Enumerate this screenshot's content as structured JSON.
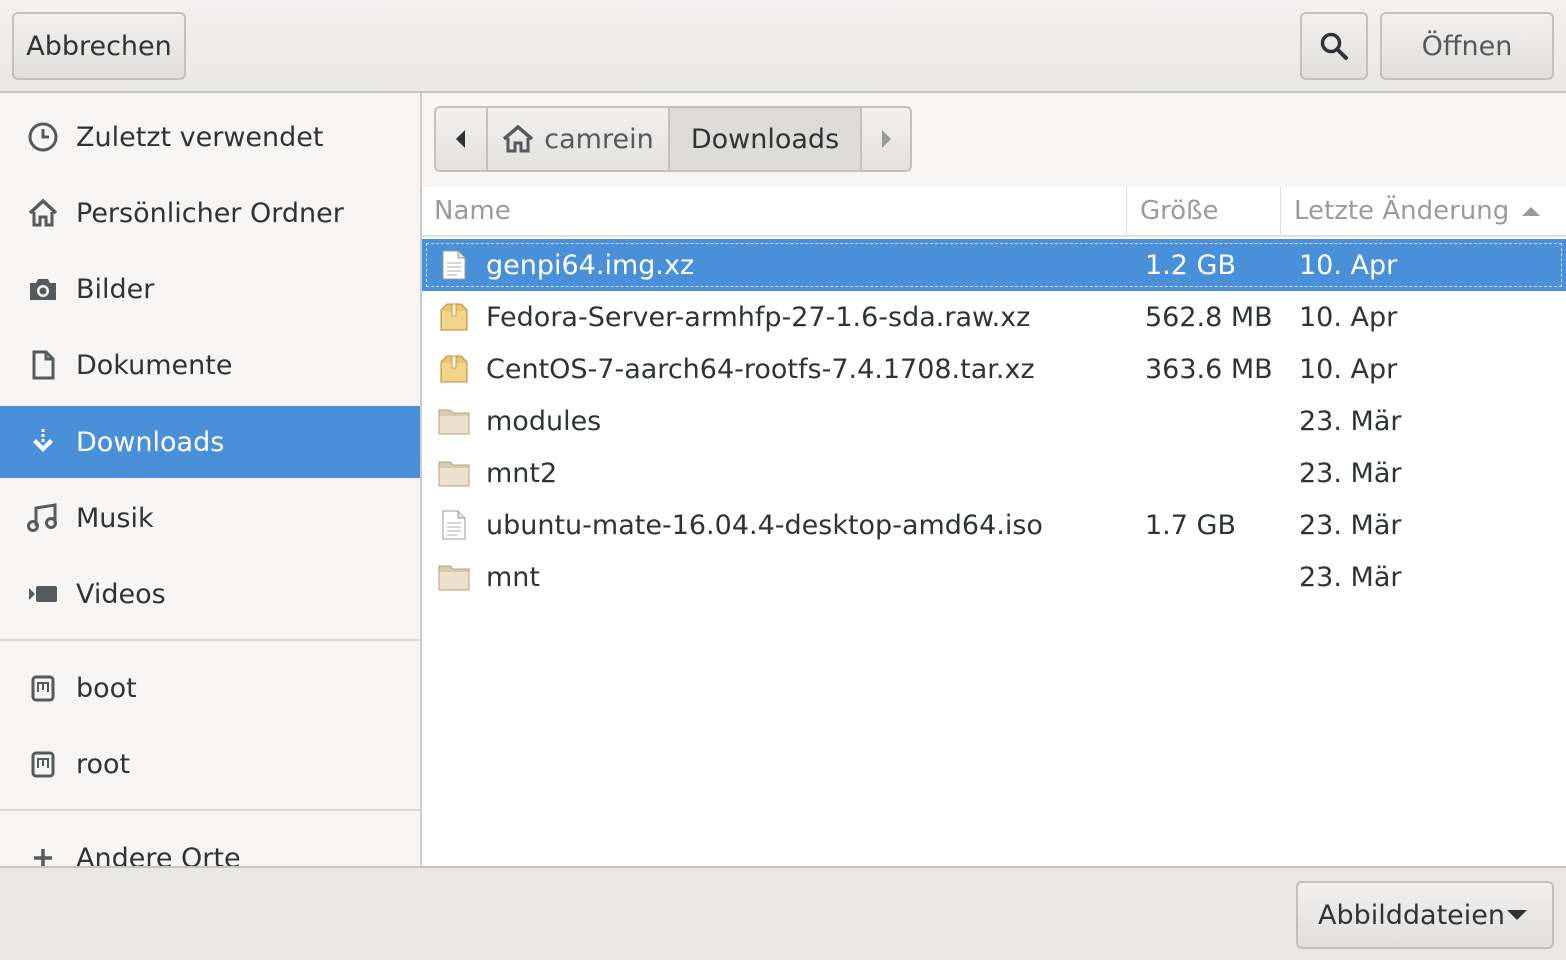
{
  "header": {
    "cancel_label": "Abbrechen",
    "open_label": "Öffnen",
    "search_icon": "search-icon"
  },
  "sidebar": {
    "items": [
      {
        "label": "Zuletzt verwendet",
        "icon": "clock-icon"
      },
      {
        "label": "Persönlicher Ordner",
        "icon": "home-icon"
      },
      {
        "label": "Bilder",
        "icon": "camera-icon"
      },
      {
        "label": "Dokumente",
        "icon": "document-icon"
      },
      {
        "label": "Downloads",
        "icon": "download-icon",
        "active": true
      },
      {
        "label": "Musik",
        "icon": "music-icon"
      },
      {
        "label": "Videos",
        "icon": "video-icon"
      }
    ],
    "devices": [
      {
        "label": "boot",
        "icon": "drive-icon"
      },
      {
        "label": "root",
        "icon": "drive-icon"
      }
    ],
    "other_label": "Andere Orte"
  },
  "pathbar": {
    "home_label": "camrein",
    "current_label": "Downloads"
  },
  "columns": {
    "name": "Name",
    "size": "Größe",
    "modified": "Letzte Änderung"
  },
  "files": [
    {
      "name": "genpi64.img.xz",
      "size": "1.2 GB",
      "date": "10. Apr",
      "icon": "file-icon",
      "selected": true
    },
    {
      "name": "Fedora-Server-armhfp-27-1.6-sda.raw.xz",
      "size": "562.8 MB",
      "date": "10. Apr",
      "icon": "archive-icon"
    },
    {
      "name": "CentOS-7-aarch64-rootfs-7.4.1708.tar.xz",
      "size": "363.6 MB",
      "date": "10. Apr",
      "icon": "archive-icon"
    },
    {
      "name": "modules",
      "size": "",
      "date": "23. Mär",
      "icon": "folder-icon"
    },
    {
      "name": "mnt2",
      "size": "",
      "date": "23. Mär",
      "icon": "folder-icon"
    },
    {
      "name": "ubuntu-mate-16.04.4-desktop-amd64.iso",
      "size": "1.7 GB",
      "date": "23. Mär",
      "icon": "file-icon"
    },
    {
      "name": "mnt",
      "size": "",
      "date": "23. Mär",
      "icon": "folder-icon"
    }
  ],
  "filter": {
    "label": "Abbilddateien"
  },
  "colors": {
    "accent": "#4a90d9"
  }
}
